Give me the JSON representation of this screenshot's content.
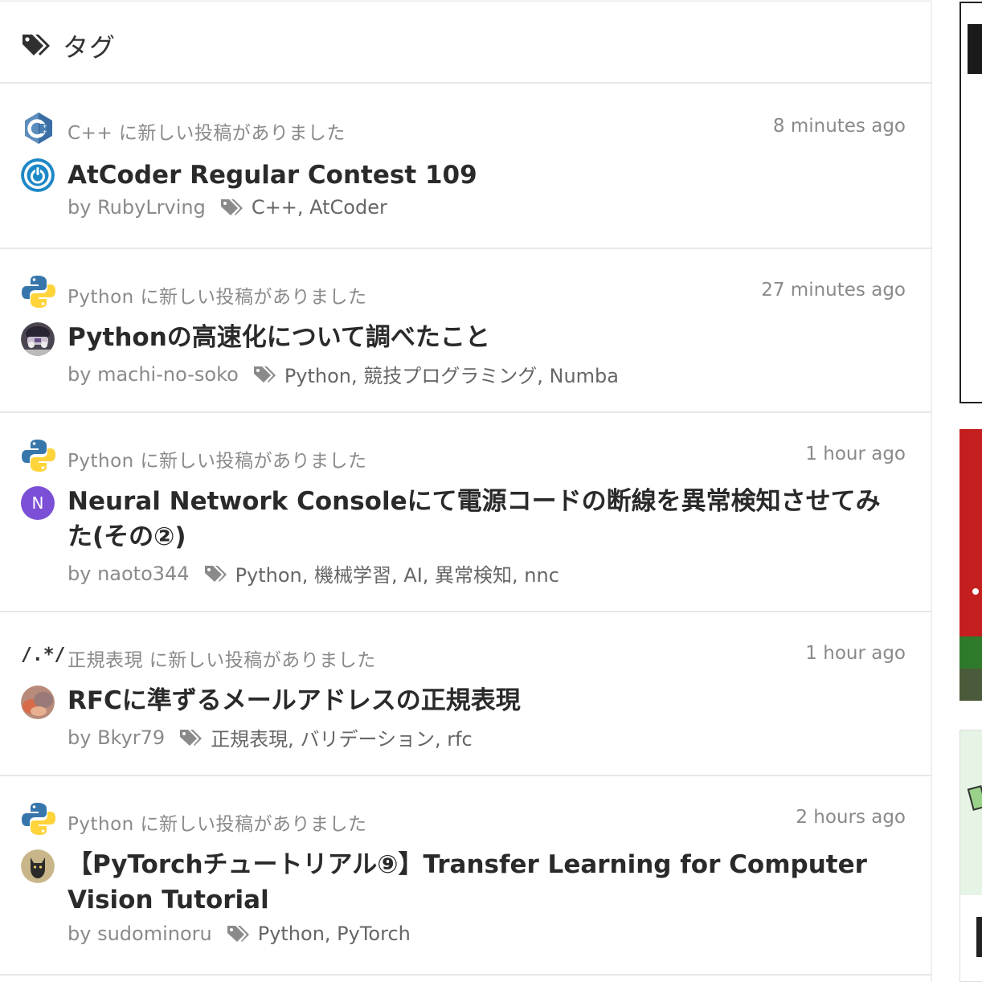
{
  "header": {
    "title": "タグ",
    "icon": "tags-icon"
  },
  "feed": [
    {
      "topic_icon": "cpp-logo-icon",
      "notice": "C++ に新しい投稿がありました",
      "time": "8 minutes ago",
      "avatar": "power-button-avatar",
      "title": "AtCoder Regular Contest 109",
      "author": "by RubyLrving",
      "tags": "C++, AtCoder"
    },
    {
      "topic_icon": "python-logo-icon",
      "notice": "Python に新しい投稿がありました",
      "time": "27 minutes ago",
      "avatar": "robot-photo-avatar",
      "title": "Pythonの高速化について調べたこと",
      "author": "by machi-no-soko",
      "tags": "Python, 競技プログラミング, Numba"
    },
    {
      "topic_icon": "python-logo-icon",
      "notice": "Python に新しい投稿がありました",
      "time": "1 hour ago",
      "avatar_letter": "N",
      "title": "Neural Network Consoleにて電源コードの断線を異常検知させてみた(その②)",
      "author": "by naoto344",
      "tags": "Python, 機械学習, AI, 異常検知, nnc"
    },
    {
      "topic_icon_text": "/.*/",
      "notice": "正規表現 に新しい投稿がありました",
      "time": "1 hour ago",
      "avatar": "food-photo-avatar",
      "title": "RFCに準ずるメールアドレスの正規表現",
      "author": "by Bkyr79",
      "tags": "正規表現, バリデーション, rfc"
    },
    {
      "topic_icon": "python-logo-icon",
      "notice": "Python に新しい投稿がありました",
      "time": "2 hours ago",
      "avatar": "cat-photo-avatar",
      "title": "【PyTorchチュートリアル⑨】Transfer Learning for Computer Vision Tutorial",
      "author": "by sudominoru",
      "tags": "Python, PyTorch"
    }
  ],
  "colors": {
    "text_muted": "#8a8a8a",
    "title": "#2a2a2a",
    "divider": "#e8e8e8",
    "avatar_n": "#7b4fd6",
    "power_blue": "#1e88c7",
    "python_blue": "#3776ab",
    "python_yellow": "#ffd43b",
    "side_red": "#c41e1e"
  }
}
